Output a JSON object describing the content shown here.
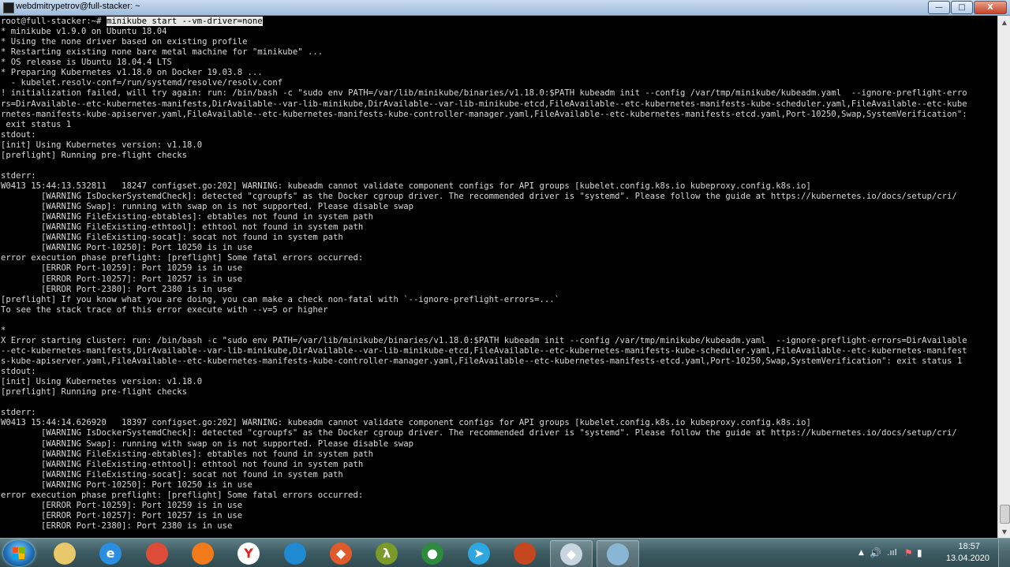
{
  "window": {
    "title": "webdmitrypetrov@full-stacker: ~",
    "minimize": "—",
    "maximize": "□",
    "close": "X"
  },
  "terminal": {
    "prompt": "root@full-stacker:~# ",
    "command": "minikube start --vm-driver=none",
    "lines": [
      "* minikube v1.9.0 on Ubuntu 18.04",
      "* Using the none driver based on existing profile",
      "* Restarting existing none bare metal machine for \"minikube\" ...",
      "* OS release is Ubuntu 18.04.4 LTS",
      "* Preparing Kubernetes v1.18.0 on Docker 19.03.8 ...",
      "  - kubelet.resolv-conf=/run/systemd/resolve/resolv.conf",
      "! initialization failed, will try again: run: /bin/bash -c \"sudo env PATH=/var/lib/minikube/binaries/v1.18.0:$PATH kubeadm init --config /var/tmp/minikube/kubeadm.yaml  --ignore-preflight-erro",
      "rs=DirAvailable--etc-kubernetes-manifests,DirAvailable--var-lib-minikube,DirAvailable--var-lib-minikube-etcd,FileAvailable--etc-kubernetes-manifests-kube-scheduler.yaml,FileAvailable--etc-kube",
      "rnetes-manifests-kube-apiserver.yaml,FileAvailable--etc-kubernetes-manifests-kube-controller-manager.yaml,FileAvailable--etc-kubernetes-manifests-etcd.yaml,Port-10250,Swap,SystemVerification\":",
      " exit status 1",
      "stdout:",
      "[init] Using Kubernetes version: v1.18.0",
      "[preflight] Running pre-flight checks",
      "",
      "stderr:",
      "W0413 15:44:13.532811   18247 configset.go:202] WARNING: kubeadm cannot validate component configs for API groups [kubelet.config.k8s.io kubeproxy.config.k8s.io]",
      "        [WARNING IsDockerSystemdCheck]: detected \"cgroupfs\" as the Docker cgroup driver. The recommended driver is \"systemd\". Please follow the guide at https://kubernetes.io/docs/setup/cri/",
      "        [WARNING Swap]: running with swap on is not supported. Please disable swap",
      "        [WARNING FileExisting-ebtables]: ebtables not found in system path",
      "        [WARNING FileExisting-ethtool]: ethtool not found in system path",
      "        [WARNING FileExisting-socat]: socat not found in system path",
      "        [WARNING Port-10250]: Port 10250 is in use",
      "error execution phase preflight: [preflight] Some fatal errors occurred:",
      "        [ERROR Port-10259]: Port 10259 is in use",
      "        [ERROR Port-10257]: Port 10257 is in use",
      "        [ERROR Port-2380]: Port 2380 is in use",
      "[preflight] If you know what you are doing, you can make a check non-fatal with `--ignore-preflight-errors=...`",
      "To see the stack trace of this error execute with --v=5 or higher",
      "",
      "*",
      "X Error starting cluster: run: /bin/bash -c \"sudo env PATH=/var/lib/minikube/binaries/v1.18.0:$PATH kubeadm init --config /var/tmp/minikube/kubeadm.yaml  --ignore-preflight-errors=DirAvailable",
      "--etc-kubernetes-manifests,DirAvailable--var-lib-minikube,DirAvailable--var-lib-minikube-etcd,FileAvailable--etc-kubernetes-manifests-kube-scheduler.yaml,FileAvailable--etc-kubernetes-manifest",
      "s-kube-apiserver.yaml,FileAvailable--etc-kubernetes-manifests-kube-controller-manager.yaml,FileAvailable--etc-kubernetes-manifests-etcd.yaml,Port-10250,Swap,SystemVerification\": exit status 1",
      "stdout:",
      "[init] Using Kubernetes version: v1.18.0",
      "[preflight] Running pre-flight checks",
      "",
      "stderr:",
      "W0413 15:44:14.626920   18397 configset.go:202] WARNING: kubeadm cannot validate component configs for API groups [kubelet.config.k8s.io kubeproxy.config.k8s.io]",
      "        [WARNING IsDockerSystemdCheck]: detected \"cgroupfs\" as the Docker cgroup driver. The recommended driver is \"systemd\". Please follow the guide at https://kubernetes.io/docs/setup/cri/",
      "        [WARNING Swap]: running with swap on is not supported. Please disable swap",
      "        [WARNING FileExisting-ebtables]: ebtables not found in system path",
      "        [WARNING FileExisting-ethtool]: ethtool not found in system path",
      "        [WARNING FileExisting-socat]: socat not found in system path",
      "        [WARNING Port-10250]: Port 10250 is in use",
      "error execution phase preflight: [preflight] Some fatal errors occurred:",
      "        [ERROR Port-10259]: Port 10259 is in use",
      "        [ERROR Port-10257]: Port 10257 is in use",
      "        [ERROR Port-2380]: Port 2380 is in use"
    ]
  },
  "taskbar": {
    "apps": [
      {
        "name": "file-explorer-icon",
        "color": "#e8c86a",
        "glyph": "",
        "active": false
      },
      {
        "name": "internet-explorer-icon",
        "color": "#2a8fe0",
        "glyph": "e",
        "active": false
      },
      {
        "name": "chrome-icon",
        "color": "#dd4b39",
        "glyph": "",
        "active": false
      },
      {
        "name": "firefox-icon",
        "color": "#f27a1a",
        "glyph": "",
        "active": false
      },
      {
        "name": "yandex-browser-icon",
        "color": "#ffffff",
        "glyph": "Y",
        "active": false
      },
      {
        "name": "vscode-icon",
        "color": "#1f8ad2",
        "glyph": "",
        "active": false
      },
      {
        "name": "git-icon",
        "color": "#e05a2b",
        "glyph": "◆",
        "active": false
      },
      {
        "name": "lambda-app-icon",
        "color": "#7a9a2a",
        "glyph": "λ",
        "active": false
      },
      {
        "name": "mongodb-compass-icon",
        "color": "#2e8b3e",
        "glyph": "●",
        "active": false
      },
      {
        "name": "telegram-icon",
        "color": "#2ea6e0",
        "glyph": "➤",
        "active": false
      },
      {
        "name": "office-app-icon",
        "color": "#c6461f",
        "glyph": "",
        "active": false
      },
      {
        "name": "terminal-app-icon",
        "color": "#c8d6e0",
        "glyph": "◆",
        "active": true
      },
      {
        "name": "notepad-icon",
        "color": "#8ab6d6",
        "glyph": "",
        "active": true
      }
    ],
    "clock_time": "18:57",
    "clock_date": "13.04.2020",
    "tray": {
      "arrow": "▲",
      "volume": "🔊",
      "signal": ".ııl",
      "flag": "⚑",
      "power": "▮"
    }
  }
}
